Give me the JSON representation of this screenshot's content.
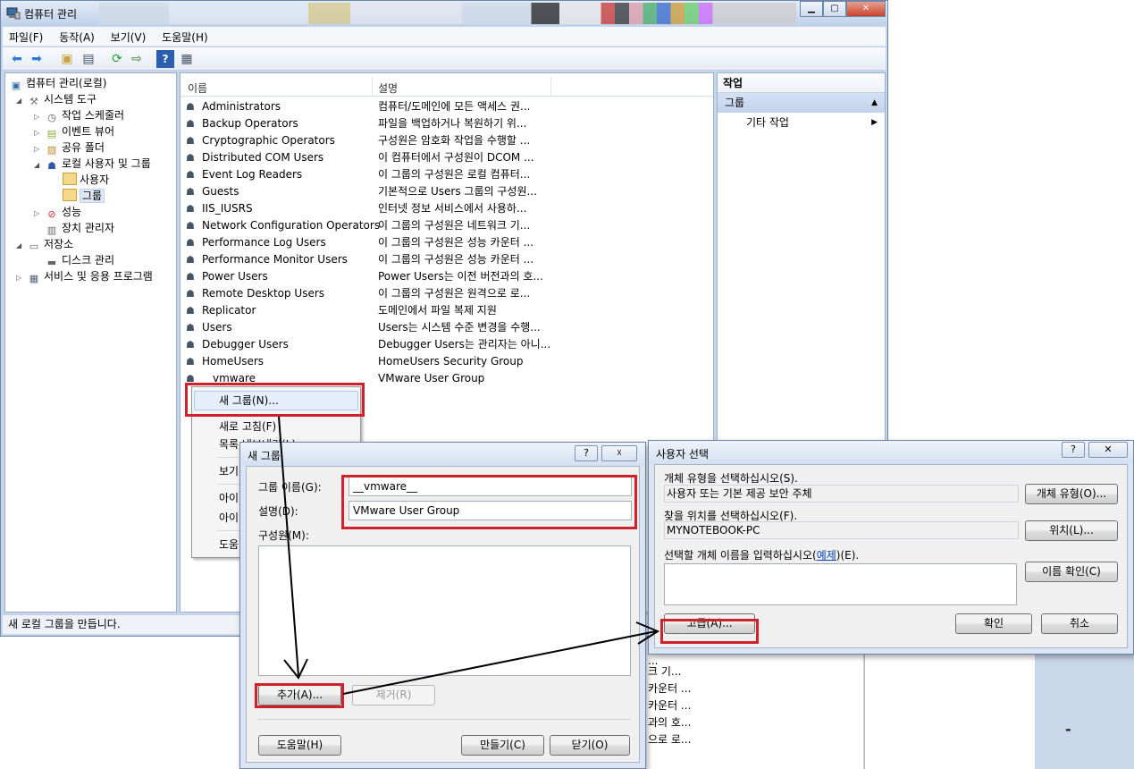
{
  "main_window": {
    "title": "컴퓨터 관리",
    "menu": [
      "파일(F)",
      "동작(A)",
      "보기(V)",
      "도움말(H)"
    ],
    "toolbar_icons": [
      "back-icon",
      "forward-icon",
      "up-folder-icon",
      "show-hide-tree-icon",
      "refresh-icon",
      "export-icon",
      "help-icon",
      "properties-icon"
    ],
    "tree": [
      {
        "label": "컴퓨터 관리(로컬)",
        "icon": "computer-management-icon",
        "level": 0,
        "expander": ""
      },
      {
        "label": "시스템 도구",
        "icon": "tools-icon",
        "level": 1,
        "expander": "▲"
      },
      {
        "label": "작업 스케줄러",
        "icon": "clock-icon",
        "level": 2,
        "expander": "▷"
      },
      {
        "label": "이벤트 뷰어",
        "icon": "event-viewer-icon",
        "level": 2,
        "expander": "▷"
      },
      {
        "label": "공유 폴더",
        "icon": "shared-folder-icon",
        "level": 2,
        "expander": "▷"
      },
      {
        "label": "로컬 사용자 및 그룹",
        "icon": "users-groups-icon",
        "level": 2,
        "expander": "▲"
      },
      {
        "label": "사용자",
        "icon": "folder-icon",
        "level": 3,
        "expander": ""
      },
      {
        "label": "그룹",
        "icon": "folder-icon",
        "level": 3,
        "expander": "",
        "selected": true
      },
      {
        "label": "성능",
        "icon": "performance-icon",
        "level": 2,
        "expander": "▷"
      },
      {
        "label": "장치 관리자",
        "icon": "device-manager-icon",
        "level": 2,
        "expander": ""
      },
      {
        "label": "저장소",
        "icon": "storage-icon",
        "level": 1,
        "expander": "▲"
      },
      {
        "label": "디스크 관리",
        "icon": "disk-icon",
        "level": 2,
        "expander": ""
      },
      {
        "label": "서비스 및 응용 프로그램",
        "icon": "services-icon",
        "level": 1,
        "expander": "▷"
      }
    ],
    "list_columns": [
      "이름",
      "설명"
    ],
    "groups": [
      {
        "name": "Administrators",
        "desc": "컴퓨터/도메인에 모든 액세스 권..."
      },
      {
        "name": "Backup Operators",
        "desc": "파일을 백업하거나 복원하기 위..."
      },
      {
        "name": "Cryptographic Operators",
        "desc": "구성원은 암호화 작업을 수행할 ..."
      },
      {
        "name": "Distributed COM Users",
        "desc": "이 컴퓨터에서 구성원이 DCOM ..."
      },
      {
        "name": "Event Log Readers",
        "desc": "이 그룹의 구성원은 로컬 컴퓨터..."
      },
      {
        "name": "Guests",
        "desc": "기본적으로 Users 그룹의 구성원..."
      },
      {
        "name": "IIS_IUSRS",
        "desc": "인터넷 정보 서비스에서 사용하..."
      },
      {
        "name": "Network Configuration Operators",
        "desc": "이 그룹의 구성원은 네트워크 기..."
      },
      {
        "name": "Performance Log Users",
        "desc": "이 그룹의 구성원은 성능 카운터 ..."
      },
      {
        "name": "Performance Monitor Users",
        "desc": "이 그룹의 구성원은 성능 카운터 ..."
      },
      {
        "name": "Power Users",
        "desc": "Power Users는 이전 버전과의 호..."
      },
      {
        "name": "Remote Desktop Users",
        "desc": "이 그룹의 구성원은 원격으로 로..."
      },
      {
        "name": "Replicator",
        "desc": "도메인에서 파일 복제 지원"
      },
      {
        "name": "Users",
        "desc": "Users는 시스템 수준 변경을 수행..."
      },
      {
        "name": "Debugger Users",
        "desc": "Debugger Users는 관리자는 아니..."
      },
      {
        "name": "HomeUsers",
        "desc": "HomeUsers Security Group"
      },
      {
        "name": "__vmware__",
        "desc": "VMware User Group"
      }
    ],
    "actions": {
      "header": "작업",
      "section": "그룹",
      "item": "기타 작업"
    },
    "status": "새 로컬 그룹을 만듭니다."
  },
  "context_menu": {
    "items": [
      "새 그룹(N)...",
      "새로 고침(F)",
      "목록 내보내기(L)...",
      "보기",
      "아이",
      "아이",
      "도움"
    ]
  },
  "background_fragments": {
    "rows": [
      "...",
      "크 기...",
      "카운터 ...",
      "카운터 ...",
      "과의 호...",
      "으로 로..."
    ],
    "dash": "-"
  },
  "new_group_dialog": {
    "title": "새 그룹",
    "help_btn": "?",
    "close_btn": "☓",
    "group_name_label": "그룹 이름(G):",
    "group_name_value": "__vmware__",
    "description_label": "설명(D):",
    "description_value": "VMware User Group",
    "members_label": "구성원(M):",
    "add_button": "추가(A)...",
    "remove_button": "제거(R)",
    "help_button": "도움말(H)",
    "create_button": "만들기(C)",
    "close_button": "닫기(O)"
  },
  "select_users_dialog": {
    "title": "사용자 선택",
    "help_btn": "?",
    "close_btn": "✕",
    "object_type_label": "개체 유형을 선택하십시오(S).",
    "object_type_value": "사용자 또는 기본 제공 보안 주체",
    "object_type_button": "개체 유형(O)...",
    "location_label": "찾을 위치를 선택하십시오(F).",
    "location_value": "MYNOTEBOOK-PC",
    "location_button": "위치(L)...",
    "enter_names_label_prefix": "선택할 개체 이름을 입력하십시오(",
    "enter_names_link": "예제",
    "enter_names_label_suffix": ")(E).",
    "check_names_button": "이름 확인(C)",
    "advanced_button": "고급(A)...",
    "ok_button": "확인",
    "cancel_button": "취소"
  },
  "colors": {
    "highlight": "#d0202a",
    "link": "#0645ad",
    "selection": "#dfe8f6"
  }
}
